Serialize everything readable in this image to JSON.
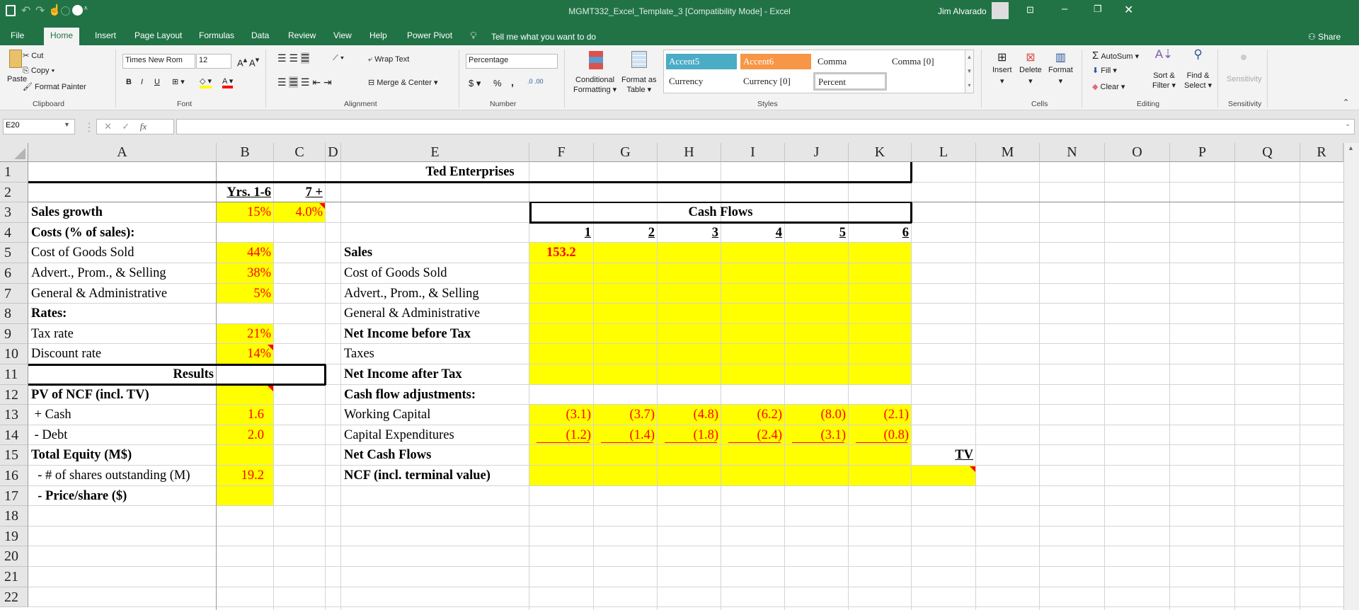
{
  "titlebar": {
    "title": "MGMT332_Excel_Template_3  [Compatibility Mode]  -  Excel",
    "user": "Jim Alvarado"
  },
  "tabs": [
    "File",
    "Home",
    "Insert",
    "Page Layout",
    "Formulas",
    "Data",
    "Review",
    "View",
    "Help",
    "Power Pivot"
  ],
  "active_tab": "Home",
  "tell_me": "Tell me what you want to do",
  "share": "Share",
  "ribbon": {
    "clipboard": {
      "label": "Clipboard",
      "paste": "Paste",
      "cut": "Cut",
      "copy": "Copy",
      "format_painter": "Format Painter"
    },
    "font": {
      "label": "Font",
      "font_name": "Times New Rom",
      "font_size": "12",
      "bold": "B",
      "italic": "I",
      "underline": "U"
    },
    "alignment": {
      "label": "Alignment",
      "wrap_text": "Wrap Text",
      "merge_center": "Merge & Center"
    },
    "number": {
      "label": "Number",
      "format": "Percentage",
      "currency": "$",
      "percent": "%",
      "comma": ","
    },
    "styles": {
      "label": "Styles",
      "conditional_formatting": [
        "Conditional",
        "Formatting"
      ],
      "format_as_table": [
        "Format as",
        "Table"
      ],
      "gallery": [
        "Accent5",
        "Accent6",
        "Comma",
        "Comma [0]",
        "Currency",
        "Currency [0]",
        "Percent"
      ],
      "accent5_color": "#4bacc6",
      "accent6_color": "#f79646"
    },
    "cells": {
      "label": "Cells",
      "insert": "Insert",
      "delete": "Delete",
      "format": "Format"
    },
    "editing": {
      "label": "Editing",
      "autosum": "AutoSum",
      "fill": "Fill",
      "clear": "Clear",
      "sort_filter": [
        "Sort &",
        "Filter"
      ],
      "find_select": [
        "Find &",
        "Select"
      ]
    },
    "sensitivity": {
      "label": "Sensitivity",
      "button": "Sensitivity"
    }
  },
  "formula_bar": {
    "name_box": "E20",
    "fx": "fx",
    "formula": ""
  },
  "columns": [
    "A",
    "B",
    "C",
    "D",
    "E",
    "F",
    "G",
    "H",
    "I",
    "J",
    "K",
    "L",
    "M",
    "N",
    "O",
    "P",
    "Q",
    "R"
  ],
  "rows": [
    "1",
    "2",
    "3",
    "4",
    "5",
    "6",
    "7",
    "8",
    "9",
    "10",
    "11",
    "12",
    "13",
    "14",
    "15",
    "16",
    "17",
    "18",
    "19",
    "20",
    "21",
    "22"
  ],
  "cells": {
    "A1": "Ted Enterprises",
    "B2": "Yrs. 1-6",
    "C2": "7 +",
    "A3": "Sales growth",
    "B3": "15%",
    "C3": "4.0%",
    "F3": "Cash Flows",
    "A4": "Costs (% of sales):",
    "F4": "1",
    "G4": "2",
    "H4": "3",
    "I4": "4",
    "J4": "5",
    "K4": "6",
    "A5": "Cost of Goods Sold",
    "B5": "44%",
    "E5": "Sales",
    "F5": "153.2",
    "A6": "Advert., Prom., & Selling",
    "B6": "38%",
    "E6": "Cost of Goods Sold",
    "A7": "General & Administrative",
    "B7": "5%",
    "E7": "Advert., Prom., & Selling",
    "A8": "Rates:",
    "E8": "General & Administrative",
    "A9": "Tax rate",
    "B9": "21%",
    "E9": "Net Income before Tax",
    "A10": "Discount rate",
    "B10": "14%",
    "E10": "Taxes",
    "A11": "Results",
    "E11": "Net Income after Tax",
    "A12": "PV of NCF (incl. TV)",
    "E12": "Cash flow adjustments:",
    "A13": " + Cash",
    "B13": "1.6",
    "E13": "Working Capital",
    "F13": "(3.1)",
    "G13": "(3.7)",
    "H13": "(4.8)",
    "I13": "(6.2)",
    "J13": "(8.0)",
    "K13": "(2.1)",
    "A14": " - Debt",
    "B14": "2.0",
    "E14": "Capital Expenditures",
    "F14": "(1.2)",
    "G14": "(1.4)",
    "H14": "(1.8)",
    "I14": "(2.4)",
    "J14": "(3.1)",
    "K14": "(0.8)",
    "A15": "Total Equity (M$)",
    "E15": "Net Cash Flows",
    "L15": "TV",
    "A16": "  - # of shares outstanding (M)",
    "B16": "19.2",
    "E16": "NCF (incl. terminal value)",
    "A17": "  - Price/share ($)"
  },
  "colors": {
    "input_fill": "#ffff00",
    "input_text": "#ff0000",
    "excel_green": "#217346"
  }
}
